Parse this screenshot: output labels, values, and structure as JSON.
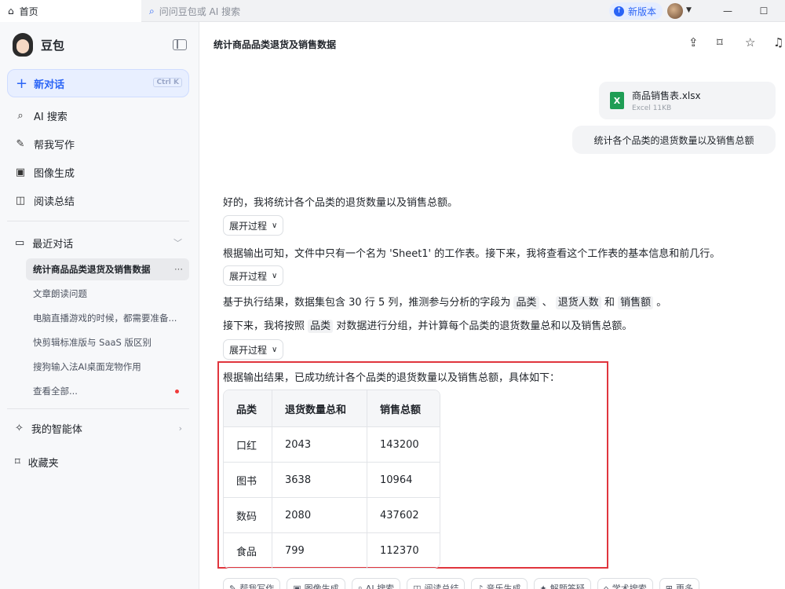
{
  "topbar": {
    "home_tab": "首页",
    "search_placeholder": "问问豆包或 AI 搜索",
    "new_version": "新版本",
    "minimize": "—",
    "maximize": "☐"
  },
  "sidebar": {
    "brand": "豆包",
    "new_chat": "新对话",
    "new_chat_shortcut": "Ctrl K",
    "nav": [
      {
        "label": "AI 搜索",
        "icon": "search-spark-icon"
      },
      {
        "label": "帮我写作",
        "icon": "pen-icon"
      },
      {
        "label": "图像生成",
        "icon": "image-icon"
      },
      {
        "label": "阅读总结",
        "icon": "book-icon"
      }
    ],
    "recent_title": "最近对话",
    "recent": [
      "统计商品品类退货及销售数据",
      "文章朗读问题",
      "电脑直播游戏的时候，都需要准备...",
      "快剪辑标准版与 SaaS 版区别",
      "搜狗输入法AI桌面宠物作用",
      "查看全部..."
    ],
    "agents": "我的智能体",
    "favorites": "收藏夹"
  },
  "main": {
    "title": "统计商品品类退货及销售数据",
    "file_name": "商品销售表.xlsx",
    "file_meta": "Excel 11KB",
    "user_message": "统计各个品类的退货数量以及销售总额",
    "expand_label": "展开过程",
    "reply_1": "好的，我将统计各个品类的退货数量以及销售总额。",
    "reply_2": "根据输出可知，文件中只有一个名为 'Sheet1' 的工作表。接下来，我将查看这个工作表的基本信息和前几行。",
    "reply_3_a": "基于执行结果，数据集包含 30 行 5 列，推测参与分析的字段为",
    "reply_3_f1": "品类",
    "reply_3_sep": "、",
    "reply_3_f2": "退货人数",
    "reply_3_and": "和",
    "reply_3_f3": "销售额",
    "reply_3_end": "。",
    "reply_4_a": "接下来，我将按照",
    "reply_4_f": "品类",
    "reply_4_b": "对数据进行分组，并计算每个品类的退货数量总和以及销售总额。",
    "result_line": "根据输出结果，已成功统计各个品类的退货数量以及销售总额，具体如下：",
    "table": {
      "headers": [
        "品类",
        "退货数量总和",
        "销售总额"
      ],
      "rows": [
        [
          "口红",
          "2043",
          "143200"
        ],
        [
          "图书",
          "3638",
          "10964"
        ],
        [
          "数码",
          "2080",
          "437602"
        ],
        [
          "食品",
          "799",
          "112370"
        ]
      ]
    },
    "tools": [
      "帮我写作",
      "图像生成",
      "AI 搜索",
      "阅读总结",
      "音乐生成",
      "解题答疑",
      "学术搜索",
      "更多"
    ]
  },
  "colors": {
    "accent": "#2a64f6",
    "highlight_border": "#e0353d",
    "excel": "#1f9d55"
  }
}
